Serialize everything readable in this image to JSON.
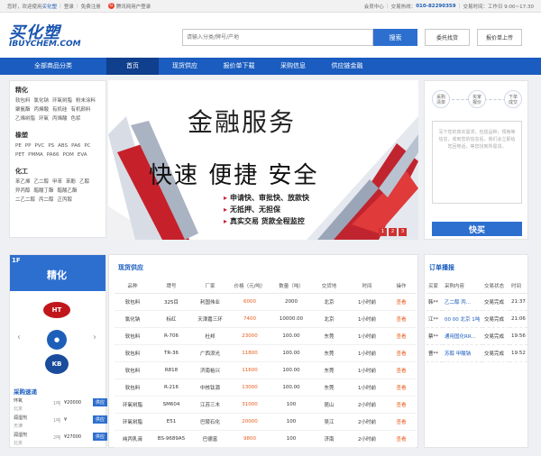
{
  "topbar": {
    "welcome": "您好，欢迎使用",
    "brand": "买化塑",
    "login": "登录",
    "register": "免费注册",
    "qq_login": "腾讯网用户登录",
    "member_center": "会员中心",
    "hotline_label": "交易热线：",
    "hotline": "010-82290359",
    "hours": "交易时间：工作日 9:00~17:30"
  },
  "header": {
    "logo_cn": "买化塑",
    "logo_en": "IBUYCHEM.COM",
    "search_placeholder": "请输入分类/牌号/产地",
    "search_button": "搜索",
    "entrust_button": "委托找货",
    "quote_button": "报价单上传"
  },
  "nav": {
    "all": "全部商品分类",
    "items": [
      "首页",
      "现货供应",
      "报价单下载",
      "采购信息",
      "供应链金融"
    ]
  },
  "categories": [
    {
      "title": "精化",
      "items": [
        "软包料",
        "氯化钠",
        "环氧树脂",
        "粉末涂料",
        "聚氨酯",
        "丙烯酸",
        "有机硅",
        "有机颜料",
        "乙烯树脂",
        "环氧",
        "丙烯酸",
        "色浆"
      ]
    },
    {
      "title": "橡塑",
      "items": [
        "PE",
        "PP",
        "PVC",
        "PS",
        "ABS",
        "PA6",
        "PC",
        "PET",
        "PMMA",
        "PA66",
        "POM",
        "EVA"
      ]
    },
    {
      "title": "化工",
      "items": [
        "苯乙烯",
        "乙二醇",
        "甲苯",
        "苯酚",
        "乙醇",
        "异丙醇",
        "醋酸丁酯",
        "醋酸乙酯",
        "二乙二醇",
        "丙二醇",
        "正丙醇"
      ]
    }
  ],
  "banner": {
    "title": "金融服务",
    "subtitle": "快速  便捷  安全",
    "points": [
      "申请快、审批快、放款快",
      "无抵押、无担保",
      "真实交易 货款全程监控"
    ],
    "pages": [
      "1",
      "2",
      "3"
    ]
  },
  "order": {
    "steps": [
      "采购\n清单",
      "买家\n报价",
      "下单\n成交"
    ],
    "placeholder": "写下您的真实需求，包括品种，规格等信息，收到您的信息后，我们会立即给您回电话，等您找到所需货。",
    "buy_button": "快买"
  },
  "brand": {
    "floor": "1F",
    "title": "精化",
    "logos": [
      "HT",
      "●",
      "KB"
    ],
    "arrow_left": "‹",
    "arrow_right": "›",
    "quick_title": "采购速递",
    "quick_rows": [
      {
        "name": "环氧",
        "sub": "北京",
        "qty": "1吨",
        "price": "¥20000",
        "button": "供应"
      },
      {
        "name": "润湿剂",
        "sub": "天津",
        "qty": "1吨",
        "price": "¥",
        "button": "供应"
      },
      {
        "name": "润湿剂",
        "sub": "北京",
        "qty": "2吨",
        "price": "¥27000",
        "button": "供应"
      }
    ]
  },
  "supply": {
    "title": "现货供应",
    "headers": [
      "品种",
      "牌号",
      "厂家",
      "价格（元/吨）",
      "数量（吨）",
      "交货地",
      "时间",
      "操作"
    ],
    "rows": [
      [
        "软包料",
        "325目",
        "利国伟业",
        "6000",
        "2000",
        "北京",
        "1小时前",
        "查看"
      ],
      [
        "氯化钠",
        "标红",
        "天津嘉三环",
        "7400",
        "10000.00",
        "北京",
        "1小时前",
        "查看"
      ],
      [
        "软包料",
        "R-706",
        "杜邦",
        "23000",
        "100.00",
        "东莞",
        "1小时前",
        "查看"
      ],
      [
        "软包料",
        "TR-36",
        "广西添光",
        "11800",
        "100.00",
        "东莞",
        "1小时前",
        "查看"
      ],
      [
        "软包料",
        "R818",
        "济南裕兴",
        "11600",
        "100.00",
        "东莞",
        "1小时前",
        "查看"
      ],
      [
        "软包料",
        "R-216",
        "中核钛源",
        "13000",
        "100.00",
        "东莞",
        "1小时前",
        "查看"
      ],
      [
        "环氧树脂",
        "SM604",
        "江苏三木",
        "31000",
        "100",
        "昆山",
        "2小时前",
        "查看"
      ],
      [
        "环氧树脂",
        "E51",
        "巴陵石化",
        "20000",
        "100",
        "吴江",
        "2小时前",
        "查看"
      ],
      [
        "纯丙乳液",
        "BS-9689A5",
        "巴德富",
        "9800",
        "100",
        "济南",
        "2小时前",
        "查看"
      ]
    ]
  },
  "feed": {
    "title": "订单播报",
    "headers": [
      "买家",
      "采购内容",
      "交易状态",
      "时间"
    ],
    "rows": [
      [
        "韩**",
        "乙二醇 丙...",
        "交易完成",
        "21:37"
      ],
      [
        "江**",
        "00 00 北京 1吨",
        "交易完成",
        "21:06"
      ],
      [
        "蔡**",
        "通用国化RR...",
        "交易完成",
        "19:56"
      ],
      [
        "曹**",
        "苏醇 甲酸钠",
        "交易完成",
        "19:52"
      ]
    ]
  }
}
